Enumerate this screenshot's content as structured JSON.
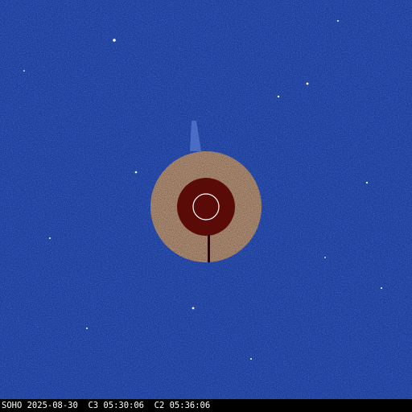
{
  "image": {
    "caption": "SOHO 2025-08-30  C3 05:30:06  C2 05:36:06"
  },
  "colors": {
    "background_blue": "#1c3f9e",
    "occulter_red": "#5a0b08",
    "sun_circle": "#ffffff",
    "caption_text": "#ffffff"
  }
}
